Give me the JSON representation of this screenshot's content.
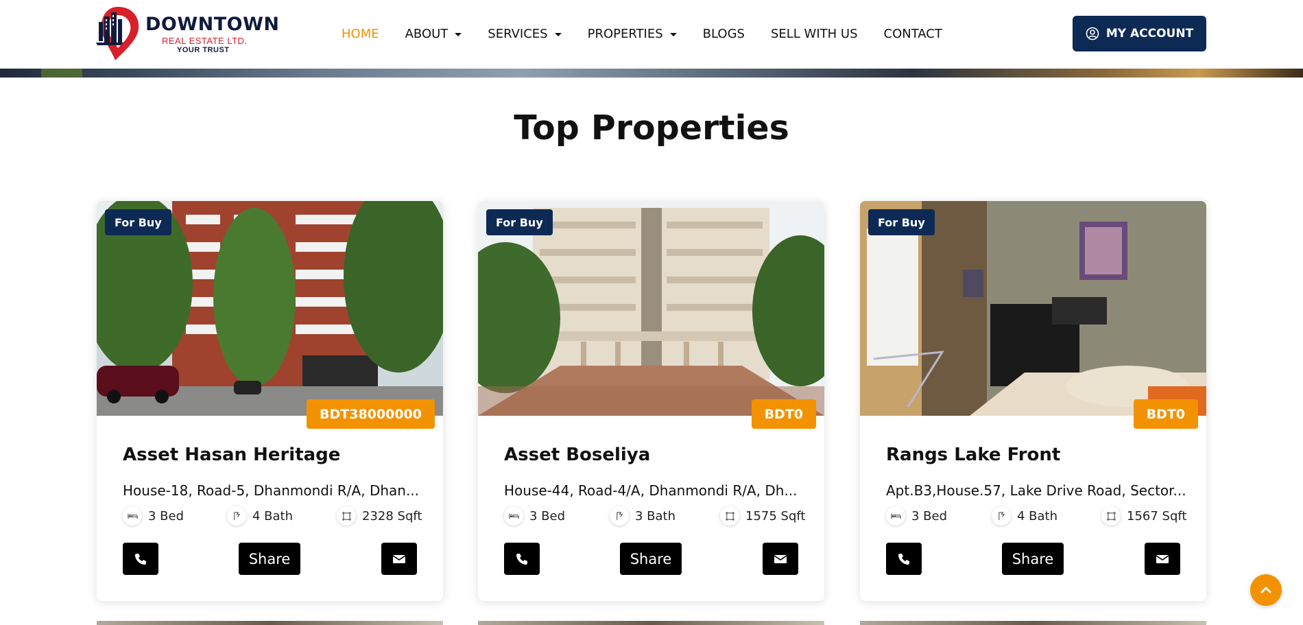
{
  "brand": {
    "name": "DOWNTOWN",
    "sub": "REAL ESTATE LTD.",
    "tagline": "YOUR TRUST"
  },
  "nav": {
    "items": [
      {
        "label": "HOME",
        "active": true,
        "dropdown": false
      },
      {
        "label": "ABOUT",
        "active": false,
        "dropdown": true
      },
      {
        "label": "SERVICES",
        "active": false,
        "dropdown": true
      },
      {
        "label": "PROPERTIES",
        "active": false,
        "dropdown": true
      },
      {
        "label": "BLOGS",
        "active": false,
        "dropdown": false
      },
      {
        "label": "SELL WITH US",
        "active": false,
        "dropdown": false
      },
      {
        "label": "CONTACT",
        "active": false,
        "dropdown": false
      }
    ],
    "account_label": "MY ACCOUNT"
  },
  "section": {
    "title": "Top Properties"
  },
  "properties": [
    {
      "status": "For Buy",
      "price": "BDT38000000",
      "title": "Asset Hasan Heritage",
      "address": "House-18, Road-5, Dhanmondi R/A, Dhan...",
      "beds": "3 Bed",
      "baths": "4 Bath",
      "area": "2328 Sqft",
      "share_label": "Share"
    },
    {
      "status": "For Buy",
      "price": "BDT0",
      "title": "Asset Boseliya",
      "address": "House-44, Road-4/A, Dhanmondi R/A, Dh...",
      "beds": "3 Bed",
      "baths": "3 Bath",
      "area": "1575 Sqft",
      "share_label": "Share"
    },
    {
      "status": "For Buy",
      "price": "BDT0",
      "title": "Rangs Lake Front",
      "address": "Apt.B3,House.57, Lake Drive Road, Sector...",
      "beds": "3 Bed",
      "baths": "4 Bath",
      "area": "1567 Sqft",
      "share_label": "Share"
    }
  ],
  "colors": {
    "accent": "#f39200",
    "navy": "#0d2a55",
    "logo_red": "#d8202a"
  },
  "icons": [
    "phone-icon",
    "envelope-icon",
    "bed-icon",
    "bath-icon",
    "area-icon",
    "user-circle-icon",
    "chevron-up-icon"
  ]
}
